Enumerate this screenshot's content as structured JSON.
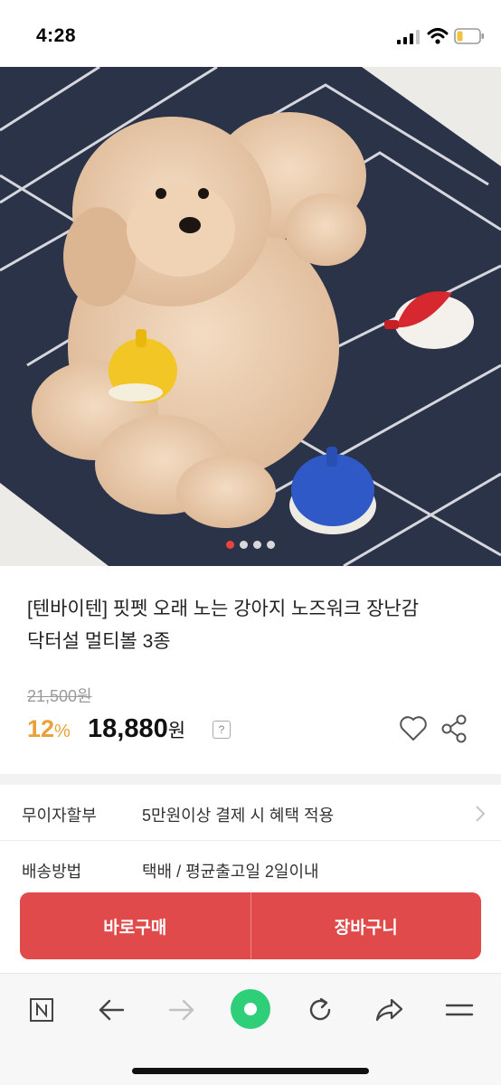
{
  "status_bar": {
    "time": "4:28"
  },
  "carousel": {
    "total": 4,
    "active_index": 0
  },
  "product": {
    "title_line1": "[텐바이텐] 핏펫 오래 노는 강아지 노즈워크 장난감",
    "title_line2": "닥터설 멀티볼 3종",
    "original_price": "21,500원",
    "discount_value": "12",
    "discount_unit": "%",
    "price_value": "18,880",
    "price_unit": "원",
    "help_label": "?"
  },
  "info_rows": [
    {
      "label": "무이자할부",
      "value": "5만원이상 결제 시 혜택 적용"
    },
    {
      "label": "배송방법",
      "value": "택배 / 평균출고일 2일이내"
    }
  ],
  "cta": {
    "buy_now": "바로구매",
    "cart": "장바구니"
  },
  "toolbar": {
    "icons": [
      "naver-home-icon",
      "back-arrow-icon",
      "forward-arrow-icon",
      "green-dot-icon",
      "refresh-icon",
      "share-arrow-icon",
      "menu-icon"
    ]
  },
  "colors": {
    "accent_red": "#e04a4a",
    "discount_orange": "#e9a23b",
    "green_button": "#2fcf7a"
  }
}
